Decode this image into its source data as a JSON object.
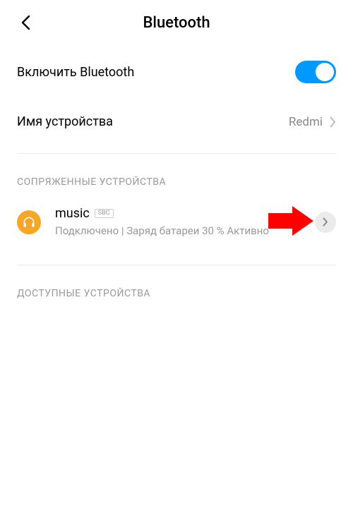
{
  "header": {
    "title": "Bluetooth"
  },
  "enable": {
    "label": "Включить Bluetooth",
    "on": true
  },
  "deviceName": {
    "label": "Имя устройства",
    "value": "Redmi"
  },
  "sections": {
    "paired": "СОПРЯЖЕННЫЕ УСТРОЙСТВА",
    "available": "ДОСТУПНЫЕ УСТРОЙСТВА"
  },
  "pairedDevice": {
    "name": "music",
    "codec": "SBC",
    "status": "Подключено | Заряд батареи 30 % Активно"
  },
  "colors": {
    "accent": "#0099ff",
    "deviceIcon": "#f7a626",
    "arrow": "#ff0000"
  }
}
